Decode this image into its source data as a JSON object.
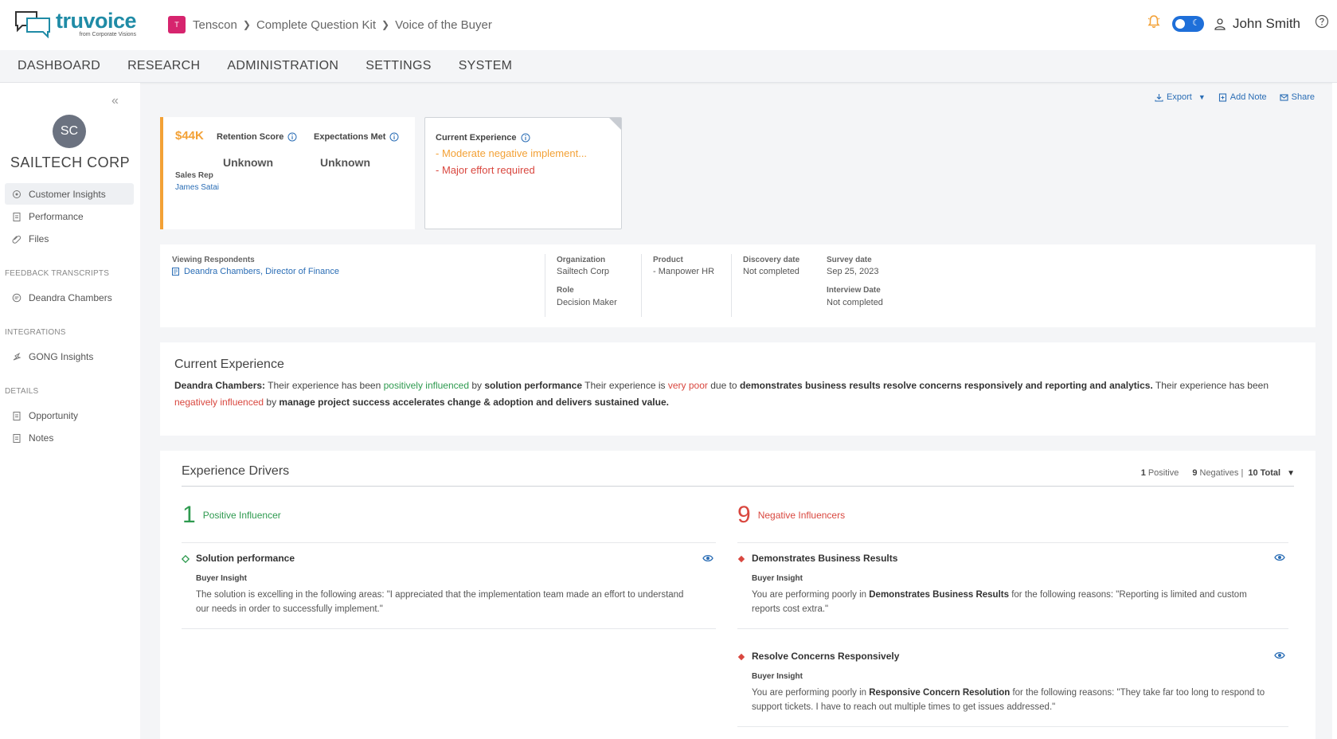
{
  "brand": {
    "name": "truvoice",
    "tagline": "from Corporate Visions"
  },
  "breadcrumb": {
    "org_initial": "T",
    "items": [
      "Tenscon",
      "Complete Question Kit",
      "Voice of the Buyer"
    ]
  },
  "user": {
    "name": "John Smith"
  },
  "nav": [
    "DASHBOARD",
    "RESEARCH",
    "ADMINISTRATION",
    "SETTINGS",
    "SYSTEM"
  ],
  "sidebar": {
    "avatar": "SC",
    "company": "SAILTECH CORP",
    "items": [
      "Customer Insights",
      "Performance",
      "Files"
    ],
    "sections": {
      "feedback": "FEEDBACK TRANSCRIPTS",
      "feedback_items": [
        "Deandra Chambers"
      ],
      "integrations": "INTEGRATIONS",
      "integration_items": [
        "GONG Insights"
      ],
      "details": "DETAILS",
      "detail_items": [
        "Opportunity",
        "Notes"
      ]
    }
  },
  "actions": {
    "export": "Export",
    "add_note": "Add Note",
    "share": "Share"
  },
  "summary": {
    "value": "$44K",
    "retention_label": "Retention Score",
    "retention_value": "Unknown",
    "expectations_label": "Expectations Met",
    "expectations_value": "Unknown",
    "sales_rep_label": "Sales Rep",
    "sales_rep": "James Satai"
  },
  "current_card": {
    "label": "Current Experience",
    "line1": "- Moderate negative implement...",
    "line2": "- Major effort required"
  },
  "respondents": {
    "viewing_label": "Viewing Respondents",
    "respondent": "Deandra Chambers, Director of Finance",
    "organization_label": "Organization",
    "organization": "Sailtech Corp",
    "role_label": "Role",
    "role": "Decision Maker",
    "product_label": "Product",
    "product": "- Manpower HR",
    "discovery_label": "Discovery date",
    "discovery": "Not completed",
    "survey_label": "Survey date",
    "survey": "Sep 25, 2023",
    "interview_label": "Interview Date",
    "interview": "Not completed"
  },
  "current_experience": {
    "title": "Current Experience",
    "name": "Deandra Chambers:",
    "t1": " Their experience has been ",
    "pos": "positively influenced",
    "t2": " by ",
    "b1": "solution performance",
    "t3": " Their experience is ",
    "vp": "very poor",
    "t4": " due to ",
    "b2": "demonstrates business results resolve concerns responsively and reporting and analytics.",
    "t5": " Their experience has been ",
    "negi": "negatively influenced",
    "t6": " by ",
    "b3": "manage project success accelerates change & adoption and delivers sustained value."
  },
  "drivers": {
    "title": "Experience Drivers",
    "positive_count": "1",
    "positive_word": "Positive",
    "negative_count": "9",
    "negative_word": "Negatives |",
    "total": "10 Total",
    "positive_header": {
      "n": "1",
      "label": "Positive Influencer"
    },
    "negative_header": {
      "n": "9",
      "label": "Negative Influencers"
    },
    "positive_items": [
      {
        "title": "Solution performance",
        "sub": "Buyer Insight",
        "text": "The solution is excelling in the following areas: \"I appreciated that the implementation team made an effort to understand our needs in order to successfully implement.\""
      }
    ],
    "negative_items": [
      {
        "title": "Demonstrates Business Results",
        "sub": "Buyer Insight",
        "pre": "You are performing poorly in ",
        "bold": "Demonstrates Business Results",
        "post": " for the following reasons: \"Reporting is limited and custom reports cost extra.\""
      },
      {
        "title": "Resolve Concerns Responsively",
        "sub": "Buyer Insight",
        "pre": "You are performing poorly in ",
        "bold": "Responsive Concern Resolution",
        "post": " for the following reasons: \"They take far too long to respond to support tickets. I have to reach out multiple times to get issues addressed.\""
      }
    ]
  },
  "colors": {
    "accent": "#1f8ba6",
    "orange": "#f3a136",
    "red": "#d9473f",
    "green": "#2e9a4f",
    "link": "#2a6db5"
  }
}
